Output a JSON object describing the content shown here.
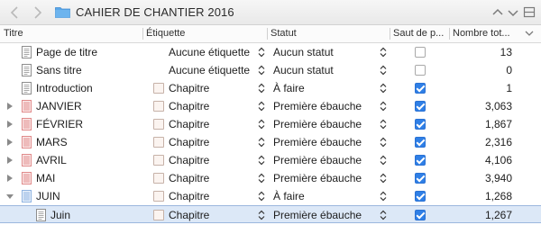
{
  "window": {
    "title": "CAHIER DE CHANTIER 2016",
    "back_icon": "chevron-left-icon",
    "forward_icon": "chevron-right-icon",
    "folder_icon": "folder-icon"
  },
  "columns": [
    {
      "label": "Titre"
    },
    {
      "label": "Étiquette"
    },
    {
      "label": "Statut"
    },
    {
      "label": "Saut de p..."
    },
    {
      "label": "Nombre tot..."
    }
  ],
  "colors": {
    "accent": "#2f7fe6",
    "selection": "#dce8f7",
    "month_icon": "#e08a8a",
    "juin_icon": "#8fb3e0"
  },
  "rows": [
    {
      "title": "Page de titre",
      "label": "Aucune étiquette",
      "status": "Aucun statut",
      "page_break": false,
      "count": "13",
      "icon": "document-icon",
      "swatch": false,
      "disclosure": "",
      "indent": 1
    },
    {
      "title": "Sans titre",
      "label": "Aucune étiquette",
      "status": "Aucun statut",
      "page_break": false,
      "count": "0",
      "icon": "document-icon",
      "swatch": false,
      "disclosure": "",
      "indent": 1
    },
    {
      "title": "Introduction",
      "label": "Chapitre",
      "status": "À faire",
      "page_break": true,
      "count": "1",
      "icon": "document-icon",
      "swatch": true,
      "disclosure": "",
      "indent": 1
    },
    {
      "title": "JANVIER",
      "label": "Chapitre",
      "status": "Première ébauche",
      "page_break": true,
      "count": "3,063",
      "icon": "stack-icon",
      "swatch": true,
      "disclosure": "collapsed",
      "indent": 1
    },
    {
      "title": "FÉVRIER",
      "label": "Chapitre",
      "status": "Première ébauche",
      "page_break": true,
      "count": "1,867",
      "icon": "stack-icon",
      "swatch": true,
      "disclosure": "collapsed",
      "indent": 1
    },
    {
      "title": "MARS",
      "label": "Chapitre",
      "status": "Première ébauche",
      "page_break": true,
      "count": "2,316",
      "icon": "stack-icon",
      "swatch": true,
      "disclosure": "collapsed",
      "indent": 1
    },
    {
      "title": "AVRIL",
      "label": "Chapitre",
      "status": "Première ébauche",
      "page_break": true,
      "count": "4,106",
      "icon": "stack-icon",
      "swatch": true,
      "disclosure": "collapsed",
      "indent": 1
    },
    {
      "title": "MAI",
      "label": "Chapitre",
      "status": "Première ébauche",
      "page_break": true,
      "count": "3,940",
      "icon": "stack-icon",
      "swatch": true,
      "disclosure": "collapsed",
      "indent": 1
    },
    {
      "title": "JUIN",
      "label": "Chapitre",
      "status": "À faire",
      "page_break": true,
      "count": "1,268",
      "icon": "stack-icon-blue",
      "swatch": true,
      "disclosure": "expanded",
      "indent": 1
    },
    {
      "title": "Juin",
      "label": "Chapitre",
      "status": "Première ébauche",
      "page_break": true,
      "count": "1,267",
      "icon": "document-icon",
      "swatch": true,
      "disclosure": "",
      "indent": 2,
      "selected": true
    }
  ]
}
